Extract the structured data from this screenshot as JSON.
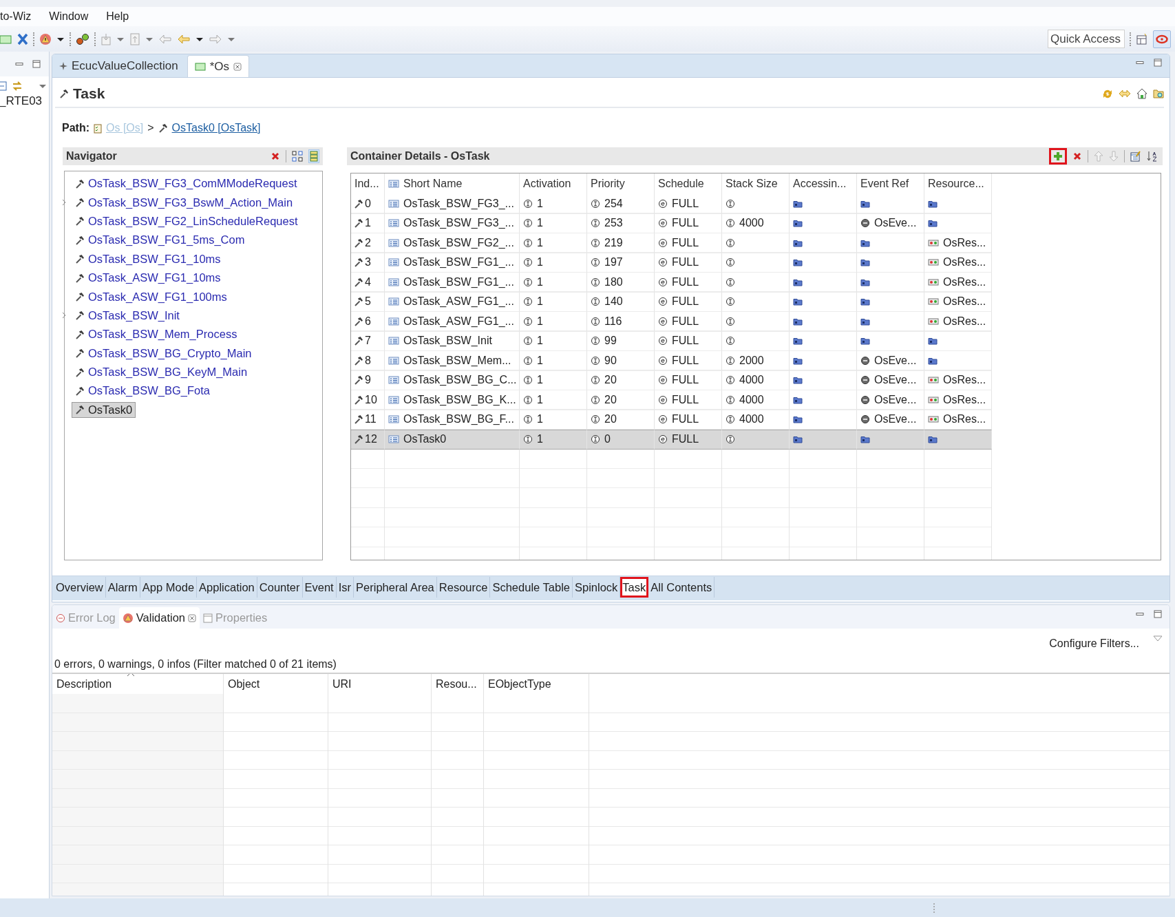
{
  "menu": [
    {
      "label": "to-Wiz"
    },
    {
      "label": "Window"
    },
    {
      "label": "Help"
    }
  ],
  "quick_access": {
    "placeholder": "Quick Access"
  },
  "left_view": {
    "items": [
      "_RTE03"
    ]
  },
  "editor_tabs": [
    {
      "label": "EcucValueCollection",
      "selected": false
    },
    {
      "label": "*Os",
      "selected": true
    }
  ],
  "page": {
    "title": "Task",
    "path": {
      "label": "Path:",
      "separator": ">",
      "parts": [
        {
          "text": "Os [Os]",
          "enabled": false
        },
        {
          "text": "OsTask0 [OsTask]",
          "enabled": true
        }
      ]
    }
  },
  "navigator": {
    "title": "Navigator",
    "items": [
      {
        "label": "OsTask_BSW_FG3_ComMModeRequest",
        "expandable": false,
        "selected": false
      },
      {
        "label": "OsTask_BSW_FG3_BswM_Action_Main",
        "expandable": true,
        "selected": false
      },
      {
        "label": "OsTask_BSW_FG2_LinScheduleRequest",
        "expandable": false,
        "selected": false
      },
      {
        "label": "OsTask_BSW_FG1_5ms_Com",
        "expandable": false,
        "selected": false
      },
      {
        "label": "OsTask_BSW_FG1_10ms",
        "expandable": false,
        "selected": false
      },
      {
        "label": "OsTask_ASW_FG1_10ms",
        "expandable": false,
        "selected": false
      },
      {
        "label": "OsTask_ASW_FG1_100ms",
        "expandable": false,
        "selected": false
      },
      {
        "label": "OsTask_BSW_Init",
        "expandable": true,
        "selected": false
      },
      {
        "label": "OsTask_BSW_Mem_Process",
        "expandable": false,
        "selected": false
      },
      {
        "label": "OsTask_BSW_BG_Crypto_Main",
        "expandable": false,
        "selected": false
      },
      {
        "label": "OsTask_BSW_BG_KeyM_Main",
        "expandable": false,
        "selected": false
      },
      {
        "label": "OsTask_BSW_BG_Fota",
        "expandable": false,
        "selected": false
      },
      {
        "label": "OsTask0",
        "expandable": false,
        "selected": true
      }
    ]
  },
  "details": {
    "title": "Container Details - OsTask",
    "add_highlighted": true,
    "columns": [
      "Ind...",
      "Short Name",
      "Activation",
      "Priority",
      "Schedule",
      "Stack Size",
      "Accessin...",
      "Event Ref",
      "Resource..."
    ],
    "rows": [
      {
        "index": "0",
        "short_name": "OsTask_BSW_FG3_...",
        "activation": "1",
        "priority": "254",
        "schedule": "FULL",
        "selected": false
      },
      {
        "index": "1",
        "short_name": "OsTask_BSW_FG3_...",
        "activation": "1",
        "priority": "253",
        "schedule": "FULL",
        "stack_size": "4000",
        "event_ref": "OsEve...",
        "selected": false
      },
      {
        "index": "2",
        "short_name": "OsTask_BSW_FG2_...",
        "activation": "1",
        "priority": "219",
        "schedule": "FULL",
        "resource": "OsRes...",
        "selected": false
      },
      {
        "index": "3",
        "short_name": "OsTask_BSW_FG1_...",
        "activation": "1",
        "priority": "197",
        "schedule": "FULL",
        "resource": "OsRes...",
        "selected": false
      },
      {
        "index": "4",
        "short_name": "OsTask_BSW_FG1_...",
        "activation": "1",
        "priority": "180",
        "schedule": "FULL",
        "resource": "OsRes...",
        "selected": false
      },
      {
        "index": "5",
        "short_name": "OsTask_ASW_FG1_...",
        "activation": "1",
        "priority": "140",
        "schedule": "FULL",
        "resource": "OsRes...",
        "selected": false
      },
      {
        "index": "6",
        "short_name": "OsTask_ASW_FG1_...",
        "activation": "1",
        "priority": "116",
        "schedule": "FULL",
        "resource": "OsRes...",
        "selected": false
      },
      {
        "index": "7",
        "short_name": "OsTask_BSW_Init",
        "activation": "1",
        "priority": "99",
        "schedule": "FULL",
        "selected": false
      },
      {
        "index": "8",
        "short_name": "OsTask_BSW_Mem...",
        "activation": "1",
        "priority": "90",
        "schedule": "FULL",
        "stack_size": "2000",
        "event_ref": "OsEve...",
        "selected": false
      },
      {
        "index": "9",
        "short_name": "OsTask_BSW_BG_C...",
        "activation": "1",
        "priority": "20",
        "schedule": "FULL",
        "stack_size": "4000",
        "event_ref": "OsEve...",
        "resource": "OsRes...",
        "selected": false
      },
      {
        "index": "10",
        "short_name": "OsTask_BSW_BG_K...",
        "activation": "1",
        "priority": "20",
        "schedule": "FULL",
        "stack_size": "4000",
        "event_ref": "OsEve...",
        "resource": "OsRes...",
        "selected": false
      },
      {
        "index": "11",
        "short_name": "OsTask_BSW_BG_F...",
        "activation": "1",
        "priority": "20",
        "schedule": "FULL",
        "stack_size": "4000",
        "event_ref": "OsEve...",
        "resource": "OsRes...",
        "selected": false
      },
      {
        "index": "12",
        "short_name": "OsTask0",
        "activation": "1",
        "priority": "0",
        "schedule": "FULL",
        "selected": true
      }
    ]
  },
  "page_tabs": [
    {
      "label": "Overview",
      "selected": false,
      "highlighted": false
    },
    {
      "label": "Alarm",
      "selected": false,
      "highlighted": false
    },
    {
      "label": "App Mode",
      "selected": false,
      "highlighted": false
    },
    {
      "label": "Application",
      "selected": false,
      "highlighted": false
    },
    {
      "label": "Counter",
      "selected": false,
      "highlighted": false
    },
    {
      "label": "Event",
      "selected": false,
      "highlighted": false
    },
    {
      "label": "Isr",
      "selected": false,
      "highlighted": false
    },
    {
      "label": "Peripheral Area",
      "selected": false,
      "highlighted": false
    },
    {
      "label": "Resource",
      "selected": false,
      "highlighted": false
    },
    {
      "label": "Schedule Table",
      "selected": false,
      "highlighted": false
    },
    {
      "label": "Spinlock",
      "selected": false,
      "highlighted": false
    },
    {
      "label": "Task",
      "selected": true,
      "highlighted": true
    },
    {
      "label": "All Contents",
      "selected": false,
      "highlighted": false
    }
  ],
  "views": {
    "tabs": [
      {
        "label": "Error Log",
        "kind": "log",
        "selected": false
      },
      {
        "label": "Validation",
        "kind": "warning",
        "selected": true
      },
      {
        "label": "Properties",
        "kind": "properties",
        "selected": false
      }
    ],
    "configure_filters": "Configure Filters...",
    "summary": "0 errors, 0 warnings, 0 infos (Filter matched 0 of 21 items)",
    "columns": [
      "Description",
      "Object",
      "URI",
      "Resou...",
      "EObjectType"
    ]
  }
}
